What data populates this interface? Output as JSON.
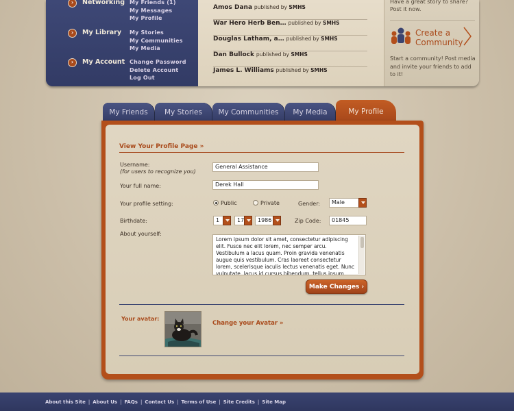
{
  "nav": {
    "groups": [
      {
        "title": "Networking",
        "links": [
          "My Friends (1)",
          "My Messages",
          "My Profile"
        ]
      },
      {
        "title": "My Library",
        "links": [
          "My Stories",
          "My Communities",
          "My Media"
        ]
      },
      {
        "title": "My Account",
        "links": [
          "Change Password",
          "Delete Account",
          "Log Out"
        ]
      }
    ]
  },
  "stories": [
    {
      "author": "Amos Dana",
      "published_by": "published by",
      "publisher": "SMHS"
    },
    {
      "author": "War Hero Herb Ben…",
      "published_by": "published by",
      "publisher": "SMHS"
    },
    {
      "author": "Douglas Latham, a…",
      "published_by": "published by",
      "publisher": "SMHS"
    },
    {
      "author": "Dan Bullock",
      "published_by": "published by",
      "publisher": "SMHS"
    },
    {
      "author": "James L. Williams",
      "published_by": "published by",
      "publisher": "SMHS"
    }
  ],
  "promo": {
    "top_text": "Have a great story to share? Post it now.",
    "title_line1": "Create a",
    "title_line2": "Community",
    "desc": "Start a community! Post media and invite your friends to add to it!"
  },
  "tabs": [
    "My Friends",
    "My Stories",
    "My Communities",
    "My Media",
    "My Profile"
  ],
  "active_tab": "My Profile",
  "form": {
    "view_link": "View Your Profile Page »",
    "username_label": "Username:",
    "username_hint": "(for users to recognize you)",
    "username_value": "General Assistance",
    "fullname_label": "Your full name:",
    "fullname_value": "Derek Hall",
    "profile_setting_label": "Your profile setting:",
    "public_label": "Public",
    "private_label": "Private",
    "gender_label": "Gender:",
    "gender_value": "Male",
    "birthdate_label": "Birthdate:",
    "birth_month": "1",
    "birth_day": "17",
    "birth_year": "1986",
    "zip_label": "Zip Code:",
    "zip_value": "01845",
    "about_label": "About yourself:",
    "about_value": "Lorem ipsum dolor sit amet, consectetur adipiscing elit. Fusce nec elit lorem, nec semper arcu. Vestibulum a lacus quam. Proin gravida venenatis augue quis vestibulum. Cras laoreet consectetur lorem, scelerisque iaculis lectus venenatis eget. Nunc vulputate, lacus id cursus bibendum, tellus ipsum pellentesque leo, pharetra mollis augue",
    "submit_label": "Make Changes ›",
    "avatar_label": "Your avatar:",
    "change_avatar": "Change your Avatar »"
  },
  "footer": {
    "links": [
      "About this Site",
      "About Us",
      "FAQs",
      "Contact Us",
      "Terms of Use",
      "Site Credits",
      "Site Map"
    ]
  },
  "colors": {
    "navy": "#3b4470",
    "rust": "#b34f1b",
    "parchment": "#ddd2bd"
  }
}
